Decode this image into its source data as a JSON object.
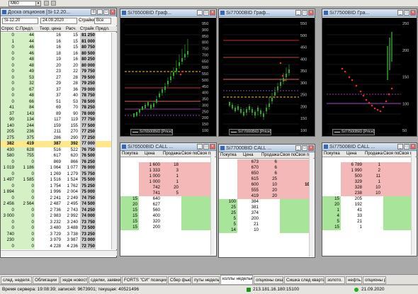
{
  "toolbar": {
    "combo_value": "M60"
  },
  "board": {
    "title": "Доска опционов [Si-12.20...",
    "underlying": "Si-12.20",
    "expiry": "24.09.2020",
    "strikes_button": "Страйки",
    "filter": "Все",
    "columns": [
      "Спрос",
      "С.Предл.",
      "Теор. цена",
      "Расч.",
      "Страйк",
      "Предл."
    ],
    "rows": [
      [
        "0",
        "44",
        "16",
        "15",
        "81 250"
      ],
      [
        "1",
        "44",
        "16",
        "15",
        "81 000"
      ],
      [
        "0",
        "46",
        "16",
        "15",
        "80 750"
      ],
      [
        "0",
        "46",
        "18",
        "16",
        "80 500"
      ],
      [
        "0",
        "48",
        "19",
        "16",
        "80 250"
      ],
      [
        "0",
        "48",
        "20",
        "20",
        "80 000"
      ],
      [
        "0",
        "49",
        "23",
        "22",
        "79 750"
      ],
      [
        "0",
        "53",
        "27",
        "28",
        "79 500"
      ],
      [
        "0",
        "32",
        "29",
        "28",
        "79 250"
      ],
      [
        "0",
        "67",
        "37",
        "36",
        "79 000"
      ],
      [
        "0",
        "48",
        "37",
        "40",
        "78 750"
      ],
      [
        "0",
        "66",
        "51",
        "53",
        "78 500"
      ],
      [
        "41",
        "84",
        "69",
        "70",
        "78 250"
      ],
      [
        "37",
        "143",
        "89",
        "90",
        "78 000"
      ],
      [
        "90",
        "134",
        "117",
        "119",
        "77 750"
      ],
      [
        "140",
        "244",
        "159",
        "155",
        "77 500"
      ],
      [
        "205",
        "236",
        "211",
        "270",
        "77 250"
      ],
      [
        "275",
        "375",
        "286",
        "290",
        "77 250"
      ],
      [
        "382",
        "419",
        "387",
        "392",
        "77 000"
      ],
      [
        "430",
        "628",
        "516",
        "522",
        "76 750"
      ],
      [
        "580",
        "755",
        "617",
        "620",
        "76 500"
      ],
      [
        "0",
        "0",
        "869",
        "866",
        "76 250"
      ],
      [
        "1 019",
        "1 186",
        "1 064",
        "1 077",
        "76 000"
      ],
      [
        "0",
        "0",
        "1 269",
        "1 279",
        "75 750"
      ],
      [
        "1 497",
        "1 585",
        "1 516",
        "1 524",
        "75 500"
      ],
      [
        "0",
        "0",
        "1 754",
        "1 762",
        "75 250"
      ],
      [
        "1 894",
        "0",
        "1 996",
        "2 004",
        "75 000"
      ],
      [
        "0",
        "0",
        "2 241",
        "2 249",
        "74 750"
      ],
      [
        "2 456",
        "2 564",
        "2 487",
        "2 495",
        "74 500"
      ],
      [
        "0",
        "0",
        "2 736",
        "2 743",
        "74 250"
      ],
      [
        "3 000",
        "0",
        "2 983",
        "2 992",
        "74 000"
      ],
      [
        "0",
        "0",
        "3 232",
        "3 240",
        "73 750"
      ],
      [
        "0",
        "0",
        "3 480",
        "3 488",
        "73 500"
      ],
      [
        "740",
        "0",
        "3 729",
        "3 738",
        "73 250"
      ],
      [
        "230",
        "0",
        "3 979",
        "3 987",
        "73 000"
      ],
      [
        "0",
        "0",
        "4 228",
        "4 236",
        "72 750"
      ]
    ]
  },
  "charts": [
    {
      "title": "Si76500BID Граф...",
      "legend": "Si76500BID [Price]",
      "yticks": [
        "950",
        "900",
        "850",
        "800",
        "750",
        "700",
        "650",
        "600",
        "550",
        "500",
        "450",
        "400",
        "350",
        "300",
        "250",
        "200",
        "150",
        "100"
      ]
    },
    {
      "title": "Si77000BID Граф...",
      "legend": "Si77000BID [Price]",
      "yticks": [
        "550",
        "500",
        "450",
        "400",
        "350",
        "300",
        "250",
        "200",
        "150",
        "100"
      ]
    },
    {
      "title": "Si77500BID Гра...",
      "legend": "Si77500BID [Price]",
      "yticks": [
        "250",
        "200",
        "150",
        "100",
        "50"
      ]
    }
  ],
  "orderbooks": [
    {
      "title": "Si76500BID CALL ...",
      "cols": [
        "Покупка",
        "Цена",
        "Продажа",
        "Своя по",
        "Своя пр"
      ],
      "asks": [
        [
          "1 600",
          "18"
        ],
        [
          "1 333",
          "3"
        ],
        [
          "1 000",
          "1"
        ],
        [
          "1 000",
          "1"
        ],
        [
          "742",
          "20"
        ],
        [
          "741",
          "5"
        ]
      ],
      "bids": [
        [
          "640",
          "15"
        ],
        [
          "627",
          "20"
        ],
        [
          "560",
          "15"
        ],
        [
          "400",
          "15"
        ],
        [
          "320",
          "15"
        ],
        [
          "200",
          "15"
        ]
      ],
      "own": ""
    },
    {
      "title": "Si77000BID CALL ...",
      "cols": [
        "Покупка",
        "Цена",
        "Продажа",
        "Своя по",
        "Своя пр"
      ],
      "asks": [
        [
          "673",
          "6"
        ],
        [
          "670",
          "6"
        ],
        [
          "650",
          "6"
        ],
        [
          "615",
          "25"
        ],
        [
          "600",
          "10"
        ],
        [
          "555",
          "20"
        ],
        [
          "419",
          "20"
        ]
      ],
      "bids": [
        [
          "384",
          "100"
        ],
        [
          "381",
          "25"
        ],
        [
          "374",
          "25"
        ],
        [
          "200",
          "5"
        ],
        [
          "21",
          "5"
        ],
        [
          "10",
          "14"
        ]
      ],
      "own": "10"
    },
    {
      "title": "Si77500BID CALL ...",
      "cols": [
        "Покупка",
        "Цена",
        "Продажа",
        "Своя по",
        "Своя пр"
      ],
      "asks": [
        [
          "6 789",
          "1"
        ],
        [
          "1 990",
          "2"
        ],
        [
          "500",
          "11"
        ],
        [
          "329",
          "1"
        ],
        [
          "328",
          "10"
        ],
        [
          "238",
          "10"
        ]
      ],
      "bids": [
        [
          "205",
          "15"
        ],
        [
          "192",
          "20"
        ],
        [
          "41",
          "1"
        ],
        [
          "33",
          "4"
        ],
        [
          "21",
          "5"
        ],
        [
          "1",
          "15"
        ]
      ],
      "own": ""
    }
  ],
  "tabs": [
    "след. неделя.",
    "Облигации",
    "хедж новости",
    "сделки, заявки",
    "FORTS \"СИ\" позиции..",
    "Сбер фьюч.",
    "путы неделька",
    "коллы неделька",
    "опционы сишка",
    "Сишка след квартал",
    "золото.",
    "нефть.",
    "опционы ртс"
  ],
  "active_tab": "коллы неделька",
  "status": {
    "server_time": "Время сервера: 19:08:39; записей: 9673901; текущая: 40521496",
    "ip": "213.181.16.180:15100",
    "date": "21.09.2020"
  }
}
